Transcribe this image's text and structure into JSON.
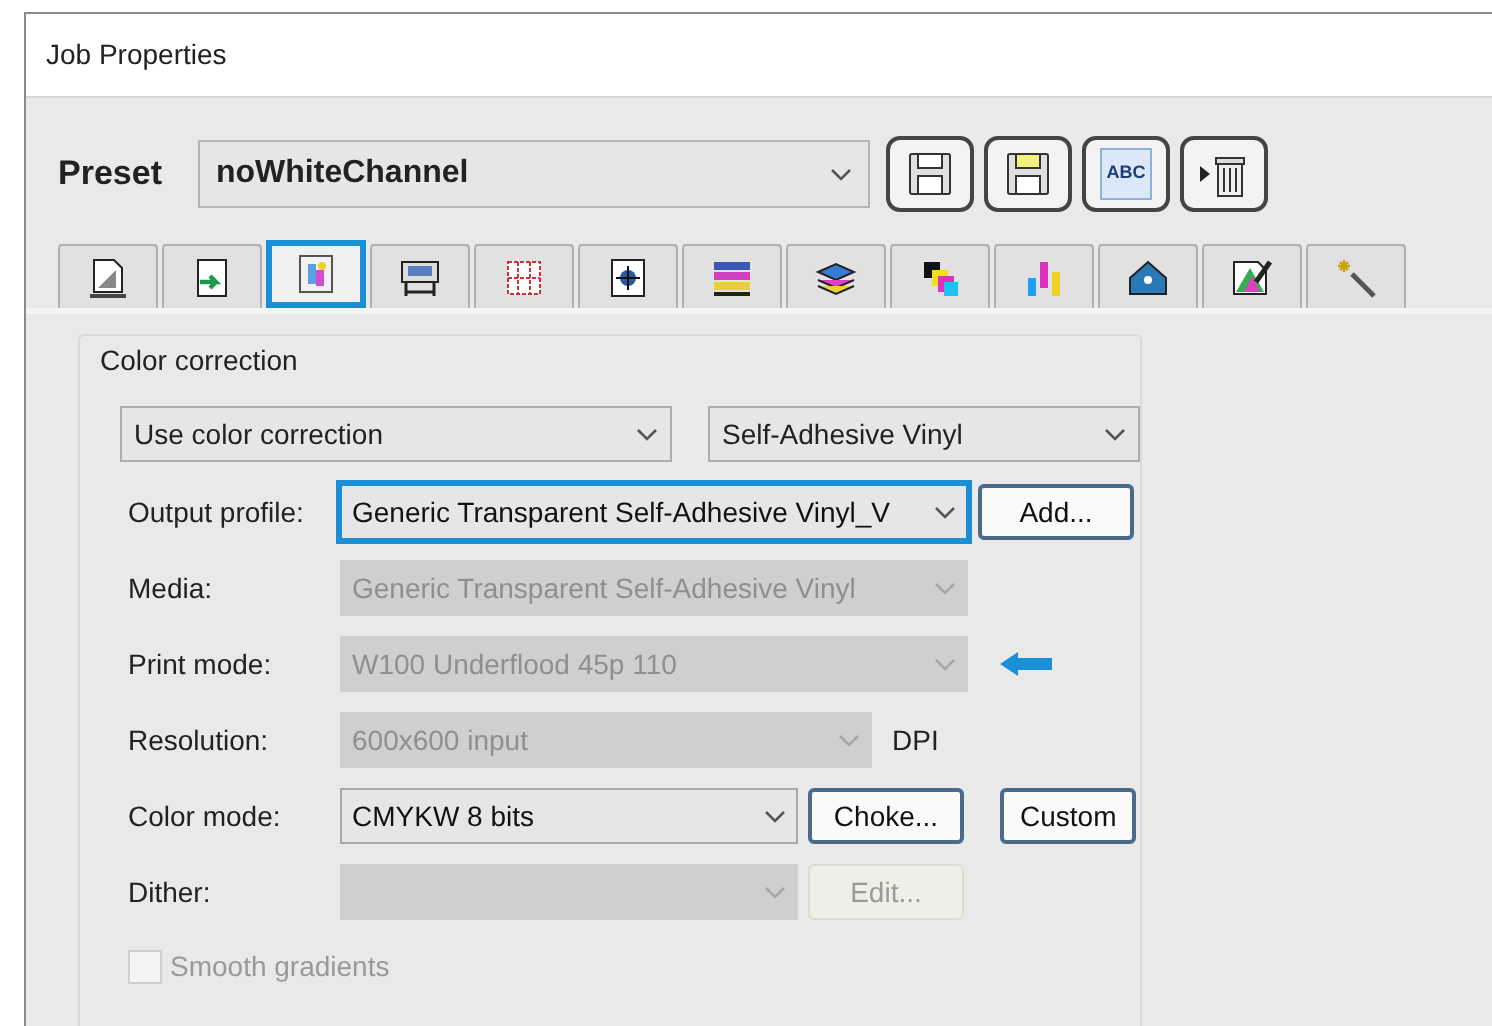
{
  "window": {
    "title": "Job Properties"
  },
  "preset": {
    "label": "Preset",
    "value": "noWhiteChannel"
  },
  "preset_buttons": [
    {
      "kind": "save"
    },
    {
      "kind": "save_as"
    },
    {
      "kind": "rename",
      "text": "ABC"
    },
    {
      "kind": "delete"
    }
  ],
  "tabs": [
    {
      "kind": "page",
      "selected": false
    },
    {
      "kind": "import",
      "selected": false
    },
    {
      "kind": "color",
      "selected": true
    },
    {
      "kind": "printer",
      "selected": false
    },
    {
      "kind": "grid",
      "selected": false
    },
    {
      "kind": "target",
      "selected": false
    },
    {
      "kind": "layers",
      "selected": false
    },
    {
      "kind": "stack",
      "selected": false
    },
    {
      "kind": "channels",
      "selected": false
    },
    {
      "kind": "bars",
      "selected": false
    },
    {
      "kind": "tag",
      "selected": false
    },
    {
      "kind": "palette",
      "selected": false
    },
    {
      "kind": "wand",
      "selected": false
    }
  ],
  "color_correction": {
    "title": "Color correction",
    "top_selects": [
      {
        "value": "Use color correction"
      },
      {
        "value": "Self-Adhesive Vinyl"
      }
    ],
    "rows": [
      {
        "label": "Output profile:",
        "value": "Generic Transparent Self-Adhesive Vinyl_V",
        "disabled": false,
        "highlighted": true,
        "marked": false,
        "buttons": [
          {
            "label": "Add...",
            "disabled": false
          }
        ]
      },
      {
        "label": "Media:",
        "value": "Generic Transparent Self-Adhesive Vinyl",
        "disabled": true,
        "highlighted": false,
        "marked": false,
        "buttons": []
      },
      {
        "label": "Print mode:",
        "value": "W100 Underflood 45p 110",
        "disabled": true,
        "highlighted": false,
        "marked": true,
        "buttons": []
      },
      {
        "label": "Resolution:",
        "value": "600x600 input",
        "disabled": true,
        "highlighted": false,
        "marked": false,
        "unit": "DPI",
        "buttons": []
      },
      {
        "label": "Color mode:",
        "value": "CMYKW 8 bits",
        "disabled": false,
        "highlighted": false,
        "marked": false,
        "buttons": [
          {
            "label": "Choke...",
            "disabled": false
          },
          {
            "label": "Custom",
            "disabled": false
          }
        ]
      },
      {
        "label": "Dither:",
        "disabled": true,
        "highlighted": false,
        "marked": false,
        "buttons": [
          {
            "label": "Edit...",
            "disabled": true
          }
        ]
      }
    ],
    "checkbox": {
      "label": "Smooth gradients",
      "checked": false,
      "disabled": true
    }
  }
}
